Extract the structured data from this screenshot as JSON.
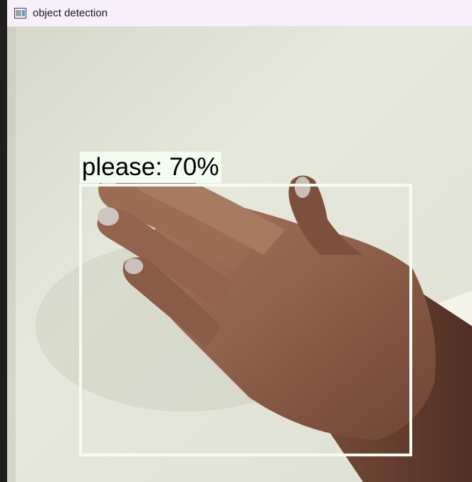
{
  "window": {
    "title": "object detection",
    "icon": "app-window-icon"
  },
  "detection": {
    "label": "please: 70%",
    "class_name": "please",
    "confidence": 0.7,
    "box_color": "#f4fbf1"
  }
}
